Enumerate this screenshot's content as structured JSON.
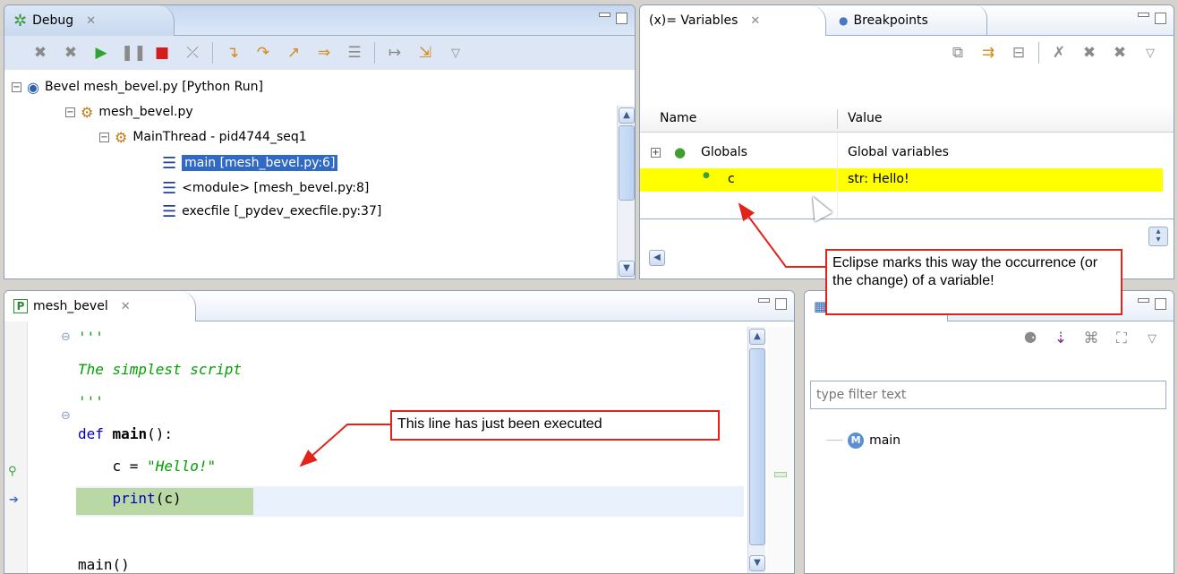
{
  "debug_view": {
    "tab_label": "Debug",
    "tree": {
      "launch": "Bevel mesh_bevel.py [Python Run]",
      "process": "mesh_bevel.py",
      "thread": "MainThread - pid4744_seq1",
      "frames": [
        "main [mesh_bevel.py:6]",
        "<module> [mesh_bevel.py:8]",
        "execfile [_pydev_execfile.py:37]"
      ]
    },
    "icons": [
      "remove-terminated-icon",
      "remove-all-icon",
      "resume-icon",
      "suspend-icon",
      "terminate-icon",
      "disconnect-icon",
      "step-into-icon",
      "step-over-icon",
      "step-return-icon",
      "drop-to-frame-icon",
      "use-step-filters-icon",
      "step-into-selection-icon",
      "smart-step-icon",
      "view-menu-icon"
    ]
  },
  "variables_view": {
    "tabs": [
      "(x)= Variables",
      "Breakpoints"
    ],
    "columns": [
      "Name",
      "Value"
    ],
    "rows": [
      {
        "name": "Globals",
        "value": "Global variables"
      },
      {
        "name": "c",
        "value": "str: Hello!",
        "highlight_color": "#ffff00"
      }
    ]
  },
  "editor": {
    "tab_label": "mesh_bevel",
    "lines": [
      "'''",
      "The simplest script",
      "'''",
      "def main():",
      "    c = \"Hello!\"",
      "    print(c)",
      "",
      "main()"
    ],
    "current_line_color": "#b9d8a4"
  },
  "outline": {
    "filter_placeholder": "type filter text",
    "items": [
      "main"
    ]
  },
  "annotations": {
    "variable_change": "Eclipse marks this way the occurrence (or the change) of a variable!",
    "executed_line": "This line has just been executed"
  }
}
